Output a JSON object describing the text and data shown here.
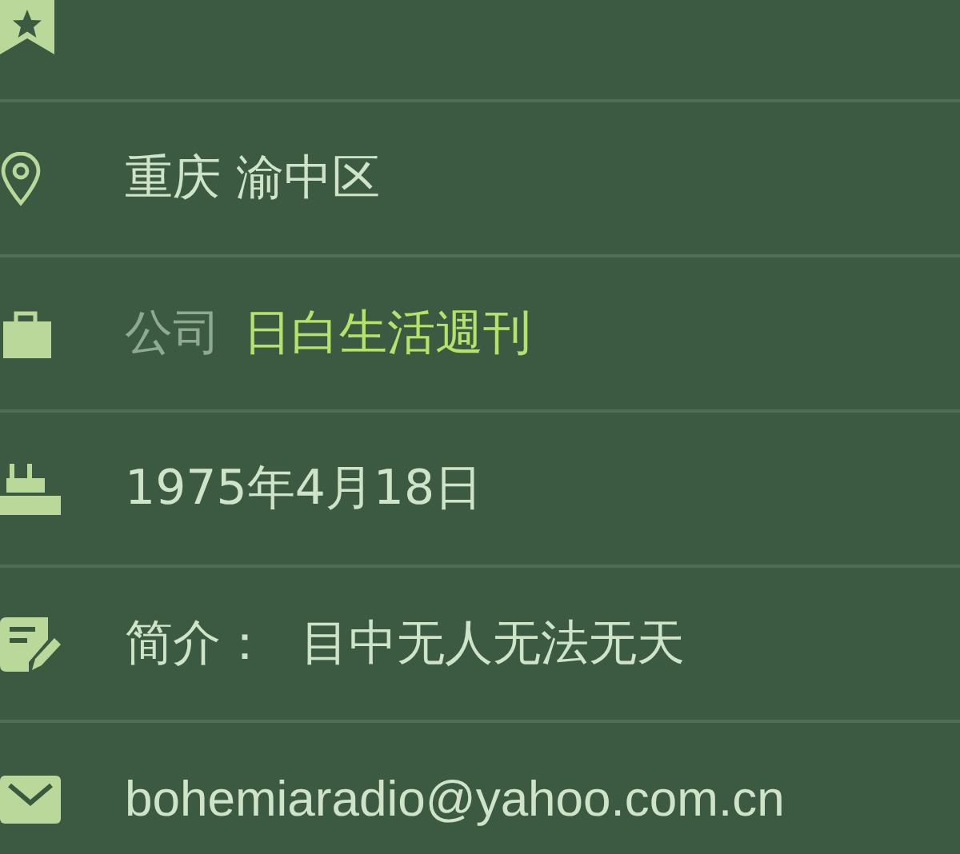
{
  "header": {
    "bookmarked": true
  },
  "rows": [
    {
      "kind": "location",
      "value": "重庆 渝中区"
    },
    {
      "kind": "company",
      "label": "公司",
      "value": "日白生活週刊"
    },
    {
      "kind": "birthday",
      "value": "1975年4月18日"
    },
    {
      "kind": "bio",
      "label": "简介：",
      "value": "目中无人无法无天"
    },
    {
      "kind": "email",
      "value": "bohemiaradio@yahoo.com.cn"
    }
  ]
}
